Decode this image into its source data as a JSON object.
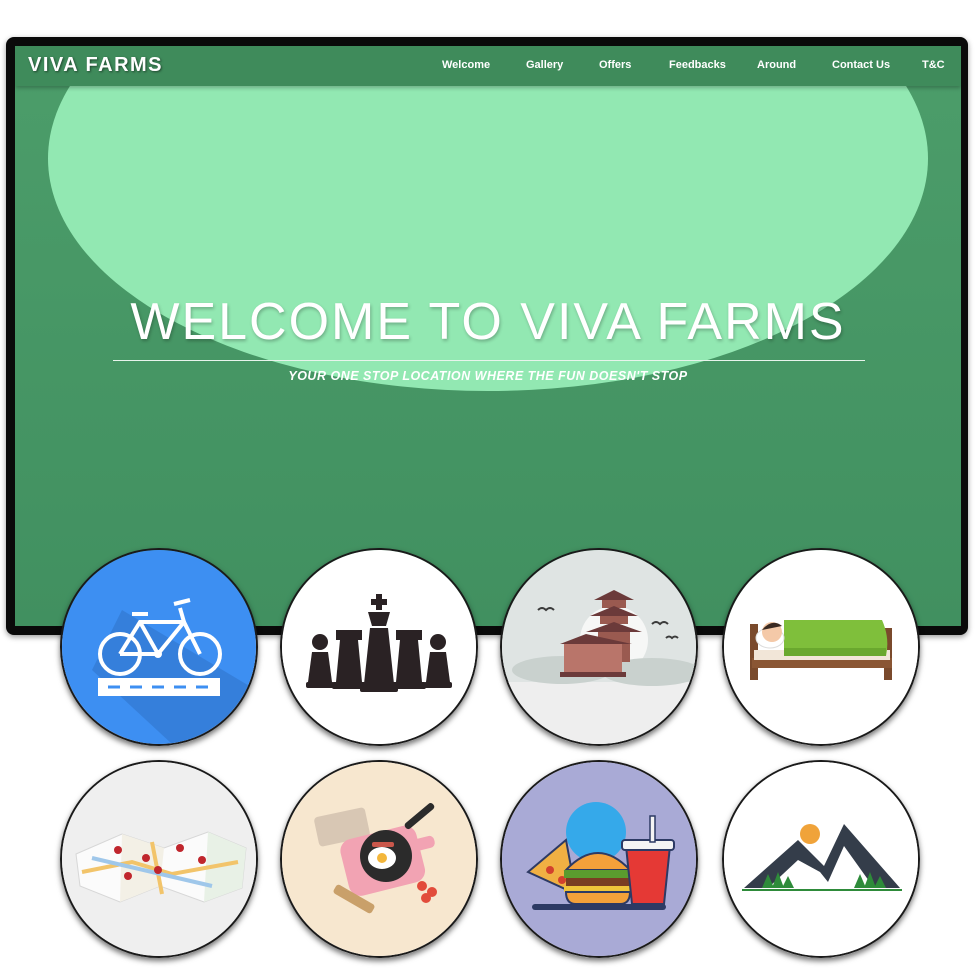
{
  "brand": {
    "name": "VIVA FARMS"
  },
  "nav": {
    "items": [
      {
        "label": "Welcome"
      },
      {
        "label": "Gallery"
      },
      {
        "label": "Offers"
      },
      {
        "label": "Feedbacks"
      },
      {
        "label": "Around"
      },
      {
        "label": "Contact Us"
      },
      {
        "label": "T&C"
      }
    ]
  },
  "hero": {
    "title": "WELCOME TO VIVA FARMS",
    "subtitle": "YOUR ONE STOP LOCATION WHERE THE FUN DOESN'T STOP"
  },
  "activities": [
    {
      "icon": "bicycle-icon"
    },
    {
      "icon": "chess-icon"
    },
    {
      "icon": "pagoda-icon"
    },
    {
      "icon": "sleeping-bed-icon"
    },
    {
      "icon": "map-icon"
    },
    {
      "icon": "cooking-icon"
    },
    {
      "icon": "fast-food-icon"
    },
    {
      "icon": "mountain-icon"
    }
  ],
  "colors": {
    "primary_green": "#419060",
    "light_green": "#92e8b2",
    "frame": "#0a0a0a"
  }
}
